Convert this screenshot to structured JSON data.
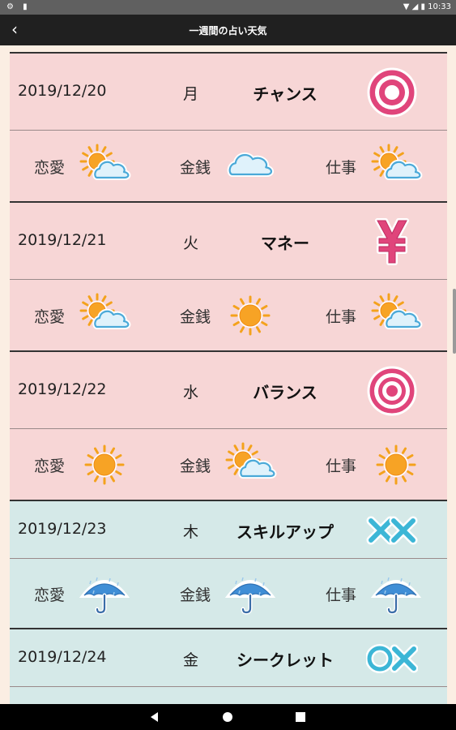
{
  "status_bar": {
    "time": "10:33"
  },
  "app_bar": {
    "title": "一週間の占い天気"
  },
  "labels": {
    "love": "恋愛",
    "money": "金銭",
    "work": "仕事"
  },
  "days": [
    {
      "date": "2019/12/20",
      "dow": "月",
      "fortune": "チャンス",
      "mark": "double-circle",
      "theme": "pink",
      "love": "sun-cloud",
      "money": "cloud",
      "work": "sun-cloud"
    },
    {
      "date": "2019/12/21",
      "dow": "火",
      "fortune": "マネー",
      "mark": "yen",
      "theme": "pink",
      "love": "sun-cloud",
      "money": "sun",
      "work": "sun-cloud"
    },
    {
      "date": "2019/12/22",
      "dow": "水",
      "fortune": "バランス",
      "mark": "triple-circle",
      "theme": "pink",
      "love": "sun",
      "money": "sun-cloud",
      "work": "sun"
    },
    {
      "date": "2019/12/23",
      "dow": "木",
      "fortune": "スキルアップ",
      "mark": "double-cross",
      "theme": "blue",
      "love": "umbrella",
      "money": "umbrella",
      "work": "umbrella"
    },
    {
      "date": "2019/12/24",
      "dow": "金",
      "fortune": "シークレット",
      "mark": "circle-cross",
      "theme": "blue"
    }
  ]
}
